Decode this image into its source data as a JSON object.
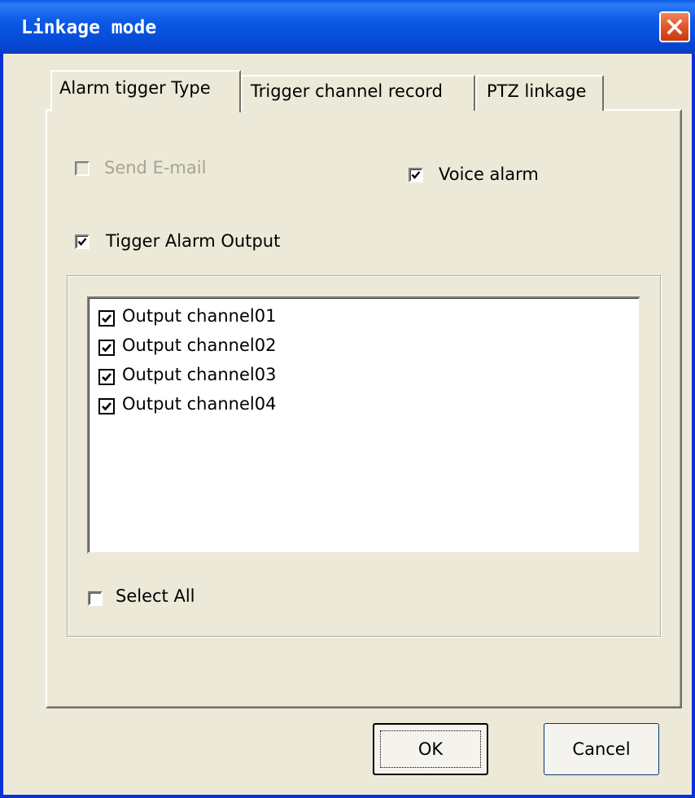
{
  "window": {
    "title": "Linkage mode",
    "close_icon": "close-icon"
  },
  "tabs": [
    {
      "label": "Alarm tigger Type",
      "selected": true
    },
    {
      "label": "Trigger channel record",
      "selected": false
    },
    {
      "label": "PTZ linkage",
      "selected": false
    }
  ],
  "options": {
    "send_email": {
      "label": "Send E-mail",
      "checked": false,
      "enabled": false
    },
    "voice_alarm": {
      "label": "Voice alarm",
      "checked": true,
      "enabled": true
    },
    "trigger_alarm_output": {
      "label": "Tigger Alarm Output",
      "checked": true,
      "enabled": true
    }
  },
  "output_channels": [
    {
      "label": "Output channel01",
      "checked": true
    },
    {
      "label": "Output channel02",
      "checked": true
    },
    {
      "label": "Output channel03",
      "checked": true
    },
    {
      "label": "Output channel04",
      "checked": true
    }
  ],
  "select_all": {
    "label": "Select All",
    "checked": false
  },
  "buttons": {
    "ok": "OK",
    "cancel": "Cancel"
  },
  "colors": {
    "titlebar": "#0a5ae8",
    "face": "#ece9d8",
    "close_button": "#e2542a"
  }
}
